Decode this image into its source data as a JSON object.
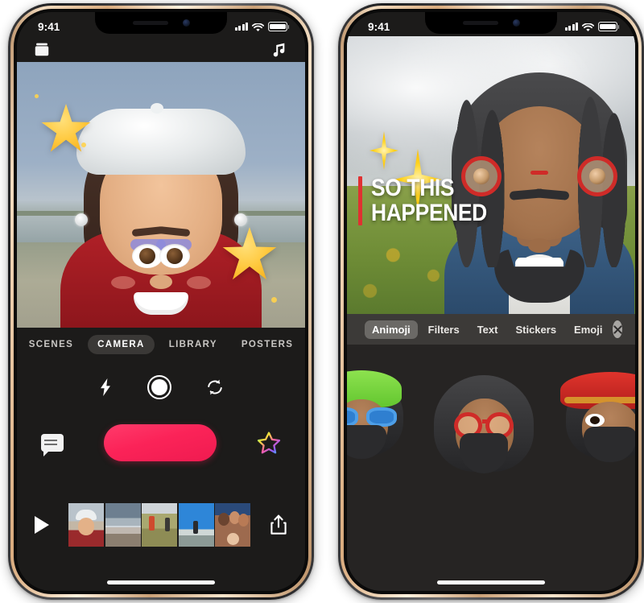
{
  "left_phone": {
    "status_bar": {
      "time": "9:41",
      "cellular": "signal-bars",
      "wifi": "wifi",
      "battery": "battery-full"
    },
    "top_toolbar": {
      "projects_icon": "projects-icon",
      "music_icon": "music-note-icon"
    },
    "preview": {
      "scene_description": "Memoji woman with white beret on beach background",
      "stickers": [
        "star",
        "star"
      ]
    },
    "tabs": [
      {
        "label": "SCENES",
        "active": false
      },
      {
        "label": "CAMERA",
        "active": true
      },
      {
        "label": "LIBRARY",
        "active": false
      },
      {
        "label": "POSTERS",
        "active": false
      }
    ],
    "camera_controls": {
      "flash_icon": "flash-icon",
      "shutter_icon": "shutter-icon",
      "flip_camera_icon": "flip-camera-icon"
    },
    "record_row": {
      "captions_icon": "live-titles-icon",
      "record_label": "",
      "effects_icon": "rainbow-star-icon",
      "record_color": "#fb2358"
    },
    "film_strip": {
      "play_icon": "play-icon",
      "share_icon": "share-icon",
      "clips": [
        {
          "name": "memoji-selfie-clip"
        },
        {
          "name": "beach-surf-clip"
        },
        {
          "name": "dunes-people-clip"
        },
        {
          "name": "beach-jump-clip"
        },
        {
          "name": "group-selfie-clip"
        }
      ]
    }
  },
  "right_phone": {
    "status_bar": {
      "time": "9:41",
      "cellular": "signal-bars",
      "wifi": "wifi",
      "battery": "battery-full"
    },
    "photo": {
      "scene_description": "Memoji man with dreadlocks and red round glasses in a field",
      "caption_line1": "SO THIS",
      "caption_line2": "HAPPENED",
      "caption_bar_color": "#e03131",
      "stickers": [
        "sparkle",
        "sparkle"
      ]
    },
    "edit_tabs": [
      {
        "label": "Animoji",
        "active": true
      },
      {
        "label": "Filters",
        "active": false
      },
      {
        "label": "Text",
        "active": false
      },
      {
        "label": "Stickers",
        "active": false
      },
      {
        "label": "Emoji",
        "active": false
      }
    ],
    "close_label": "✕",
    "animoji_tray": [
      {
        "name": "memoji-green-beanie-blue-glasses"
      },
      {
        "name": "memoji-dreadlocks-red-glasses"
      },
      {
        "name": "memoji-red-sombrero"
      }
    ]
  }
}
